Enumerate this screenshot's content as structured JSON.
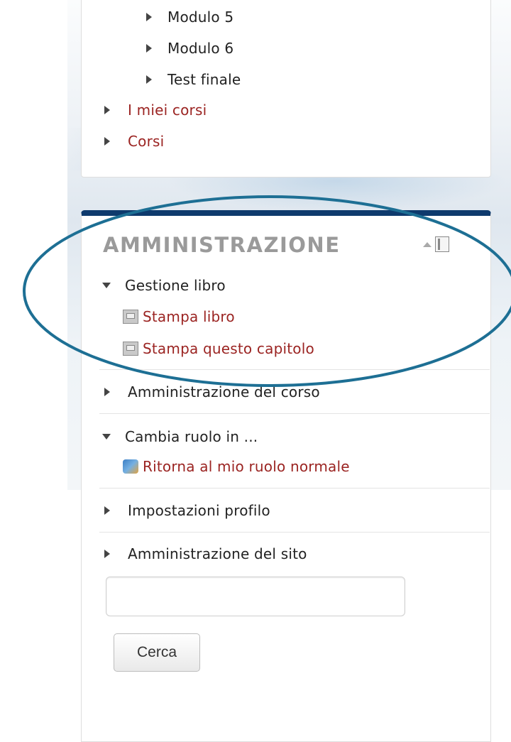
{
  "navigation": {
    "sub_items": [
      "Modulo 5",
      "Modulo 6",
      "Test finale"
    ],
    "my_courses": "I miei corsi",
    "courses": "Corsi"
  },
  "administration": {
    "title": "AMMINISTRAZIONE",
    "book_management": "Gestione libro",
    "print_book": "Stampa libro",
    "print_chapter": "Stampa questo capitolo",
    "course_admin": "Amministrazione del corso",
    "switch_role": "Cambia ruolo in ...",
    "return_role": "Ritorna al mio ruolo normale",
    "profile_settings": "Impostazioni profilo",
    "site_admin": "Amministrazione del sito"
  },
  "search": {
    "value": "",
    "button_label": "Cerca"
  },
  "colors": {
    "link": "#9b2422",
    "header_bar": "#0e3a6d",
    "annotation": "#1d6f94"
  },
  "annotation": {
    "shape": "ellipse",
    "highlights": "Gestione libro"
  }
}
